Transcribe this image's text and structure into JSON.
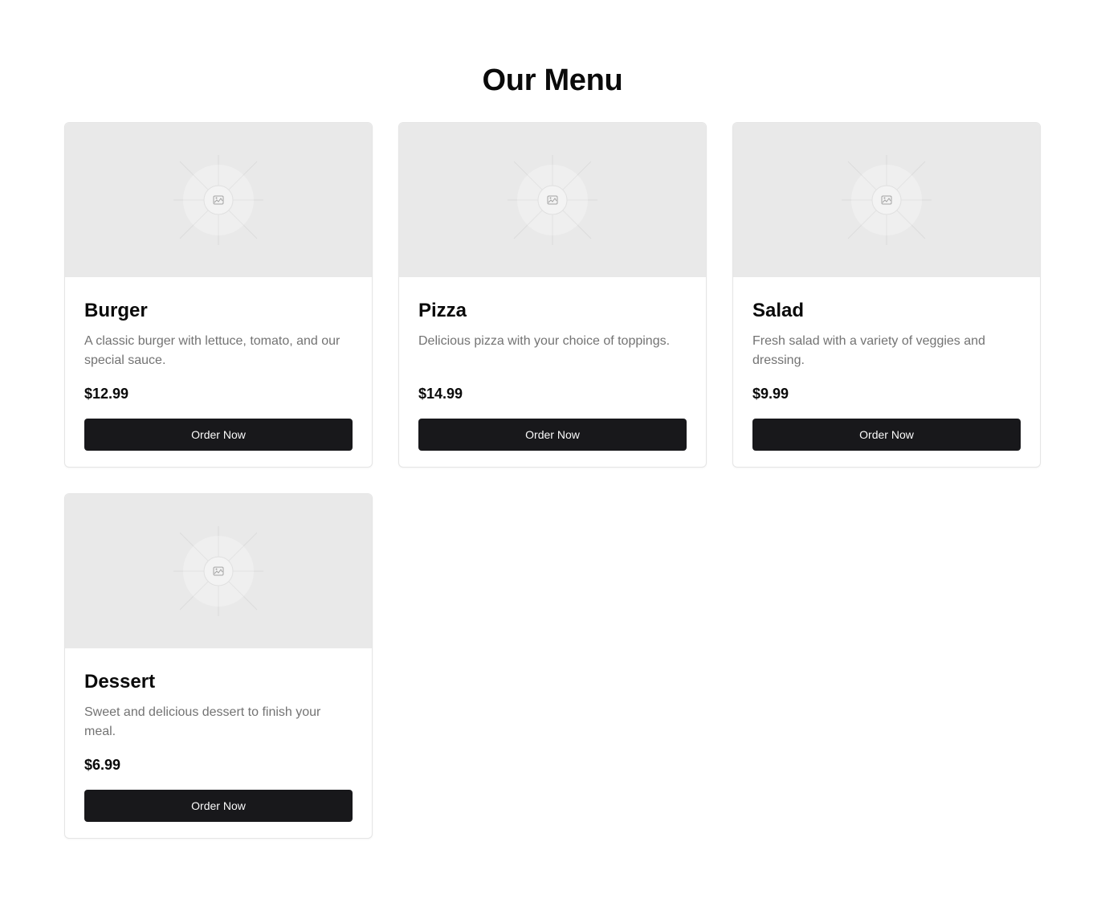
{
  "page": {
    "title": "Our Menu"
  },
  "colors": {
    "button_background": "#18181b",
    "button_text": "#fafafa",
    "description_text": "#737373",
    "image_placeholder": "#e9e9e9",
    "card_border": "#e5e5e5"
  },
  "menu": {
    "items": [
      {
        "name": "Burger",
        "description": "A classic burger with lettuce, tomato, and our special sauce.",
        "price": "$12.99",
        "button_label": "Order Now",
        "image_icon": "image-placeholder-icon"
      },
      {
        "name": "Pizza",
        "description": "Delicious pizza with your choice of toppings.",
        "price": "$14.99",
        "button_label": "Order Now",
        "image_icon": "image-placeholder-icon"
      },
      {
        "name": "Salad",
        "description": "Fresh salad with a variety of veggies and dressing.",
        "price": "$9.99",
        "button_label": "Order Now",
        "image_icon": "image-placeholder-icon"
      },
      {
        "name": "Dessert",
        "description": "Sweet and delicious dessert to finish your meal.",
        "price": "$6.99",
        "button_label": "Order Now",
        "image_icon": "image-placeholder-icon"
      }
    ]
  }
}
